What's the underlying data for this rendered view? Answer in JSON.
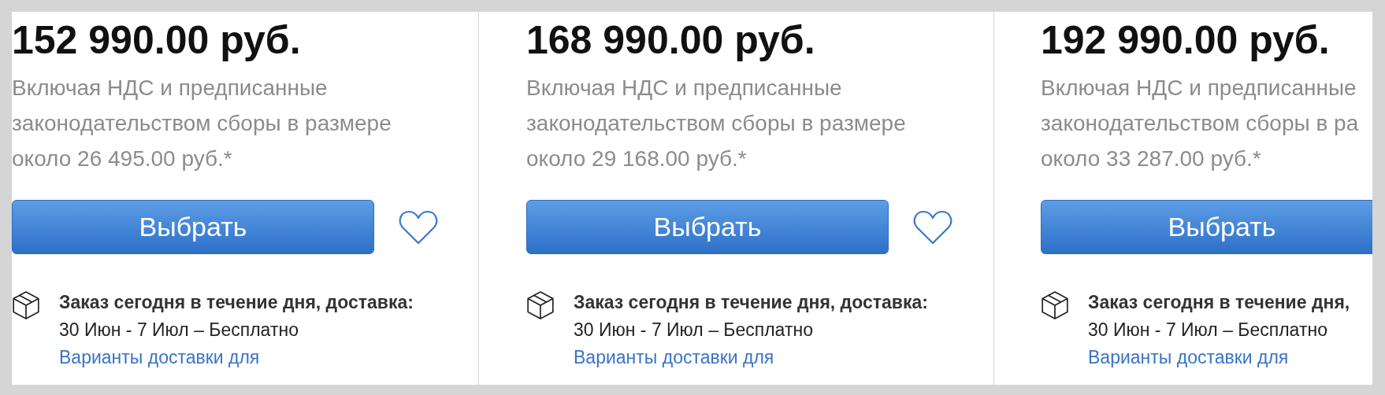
{
  "products": [
    {
      "price": "152 990.00 руб.",
      "tax_note_lines": [
        "Включая НДС и предписанные",
        "законодательством сборы в размере",
        "около 26 495.00 руб.*"
      ],
      "select_button": "Выбрать",
      "delivery_title": "Заказ сегодня в течение дня, доставка:",
      "delivery_dates": "30 Июн - 7 Июл – Бесплатно",
      "delivery_link": "Варианты доставки для"
    },
    {
      "price": "168 990.00 руб.",
      "tax_note_lines": [
        "Включая НДС и предписанные",
        "законодательством сборы в размере",
        "около 29 168.00 руб.*"
      ],
      "select_button": "Выбрать",
      "delivery_title": "Заказ сегодня в течение дня, доставка:",
      "delivery_dates": "30 Июн - 7 Июл – Бесплатно",
      "delivery_link": "Варианты доставки для"
    },
    {
      "price": "192 990.00 руб.",
      "tax_note_lines": [
        "Включая НДС и предписанные",
        "законодательством сборы в ра",
        "около 33 287.00 руб.*"
      ],
      "select_button": "Выбрать",
      "delivery_title": "Заказ сегодня в течение дня,",
      "delivery_dates": "30 Июн - 7 Июл – Бесплатно",
      "delivery_link": "Варианты доставки для"
    }
  ]
}
